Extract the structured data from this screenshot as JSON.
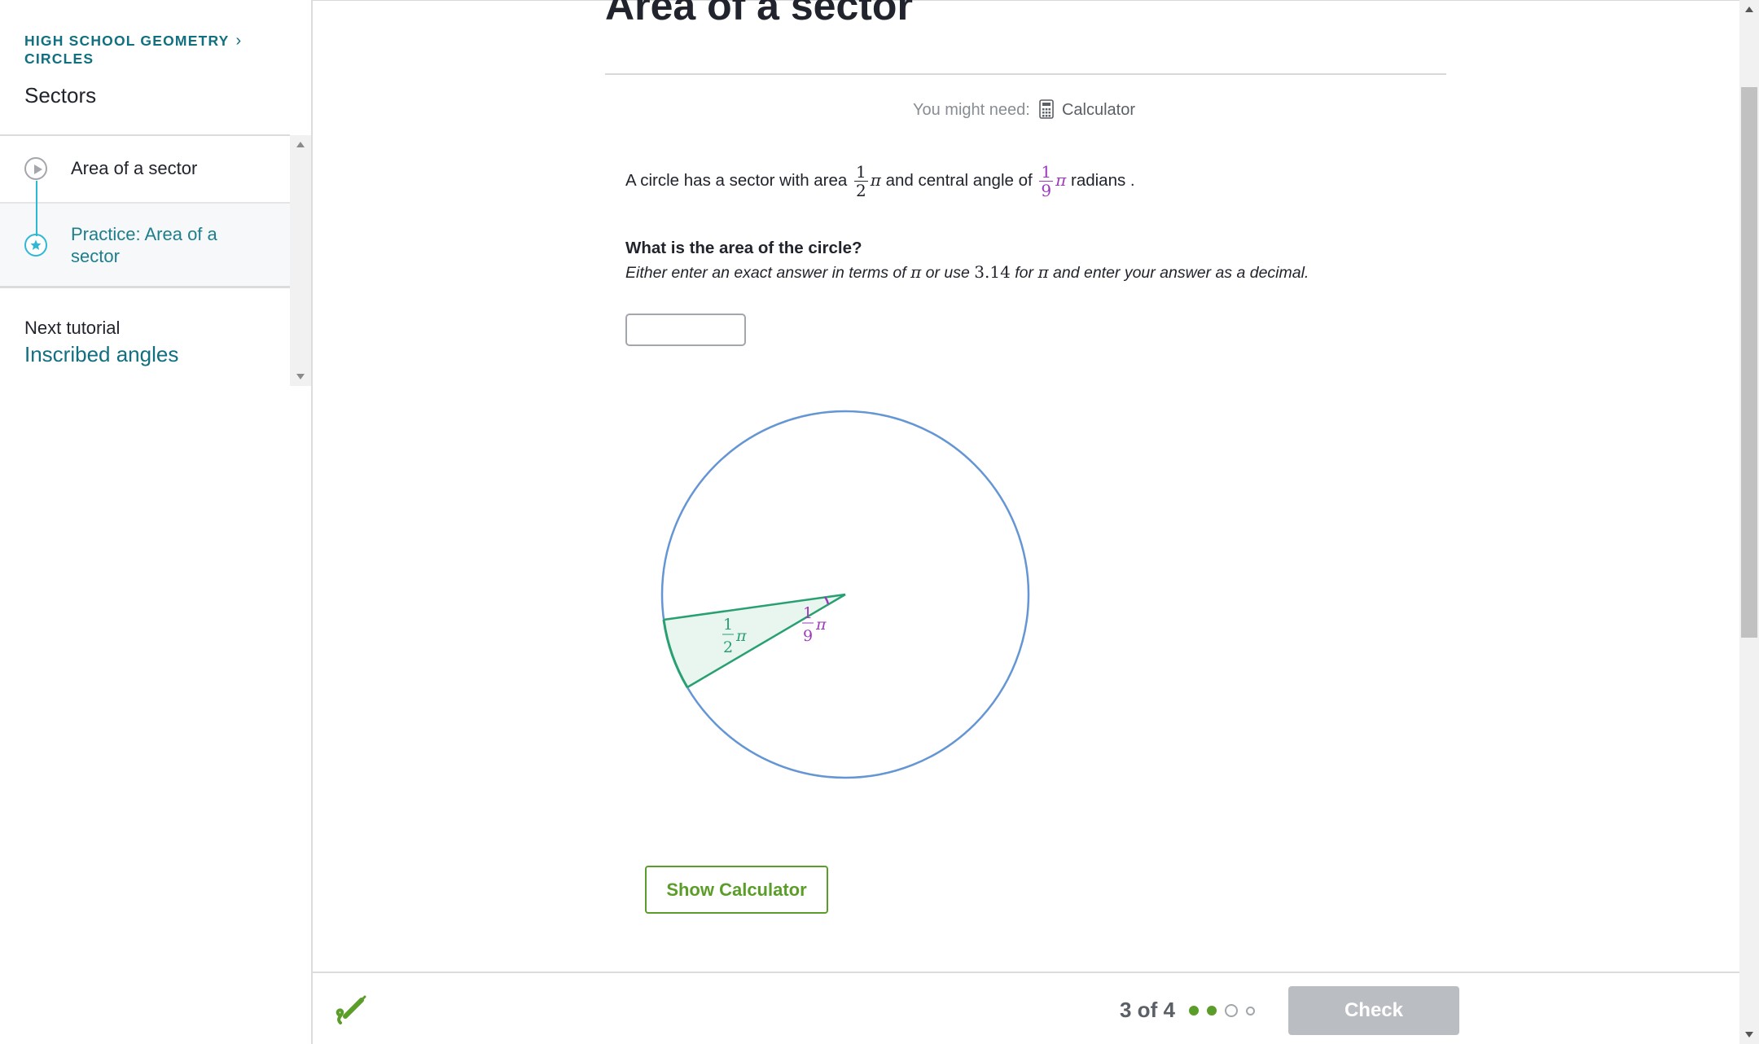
{
  "sidebar": {
    "breadcrumb_line1": "HIGH SCHOOL GEOMETRY",
    "breadcrumb_line2": "CIRCLES",
    "unit_title": "Sectors",
    "items": [
      {
        "label": "Area of a sector",
        "icon": "play-icon"
      },
      {
        "label": "Practice: Area of a sector",
        "icon": "star-icon"
      }
    ],
    "next_label": "Next tutorial",
    "next_link": "Inscribed angles"
  },
  "main": {
    "title": "Area of a sector",
    "might_need_label": "You might need:",
    "calculator_label": "Calculator",
    "question": {
      "prefix": "A circle has a sector with area",
      "area_num": "1",
      "area_den": "2",
      "pi": "π",
      "middle": "and central angle of",
      "angle_num": "1",
      "angle_den": "9",
      "suffix": "radians .",
      "bold": "What is the area of the circle?",
      "hint_a": "Either enter an exact answer in terms of",
      "hint_b": "or use",
      "hint_value": "3.14",
      "hint_c": "for",
      "hint_d": "and enter your answer as a decimal."
    },
    "answer_value": "",
    "diagram": {
      "area_label_num": "1",
      "area_label_den": "2",
      "angle_label_num": "1",
      "angle_label_den": "9",
      "pi": "π",
      "colors": {
        "circle": "#6495d4",
        "sector": "#28a071",
        "sector_fill": "#e8f6ef",
        "angle": "#9d38bd"
      }
    },
    "show_calculator": "Show Calculator"
  },
  "footer": {
    "progress": "3 of 4",
    "check": "Check",
    "progress_dots": [
      "done",
      "done",
      "current",
      "todo"
    ]
  },
  "colors": {
    "accent": "#11707f",
    "green": "#5b9d29",
    "check_disabled": "#babec2"
  }
}
